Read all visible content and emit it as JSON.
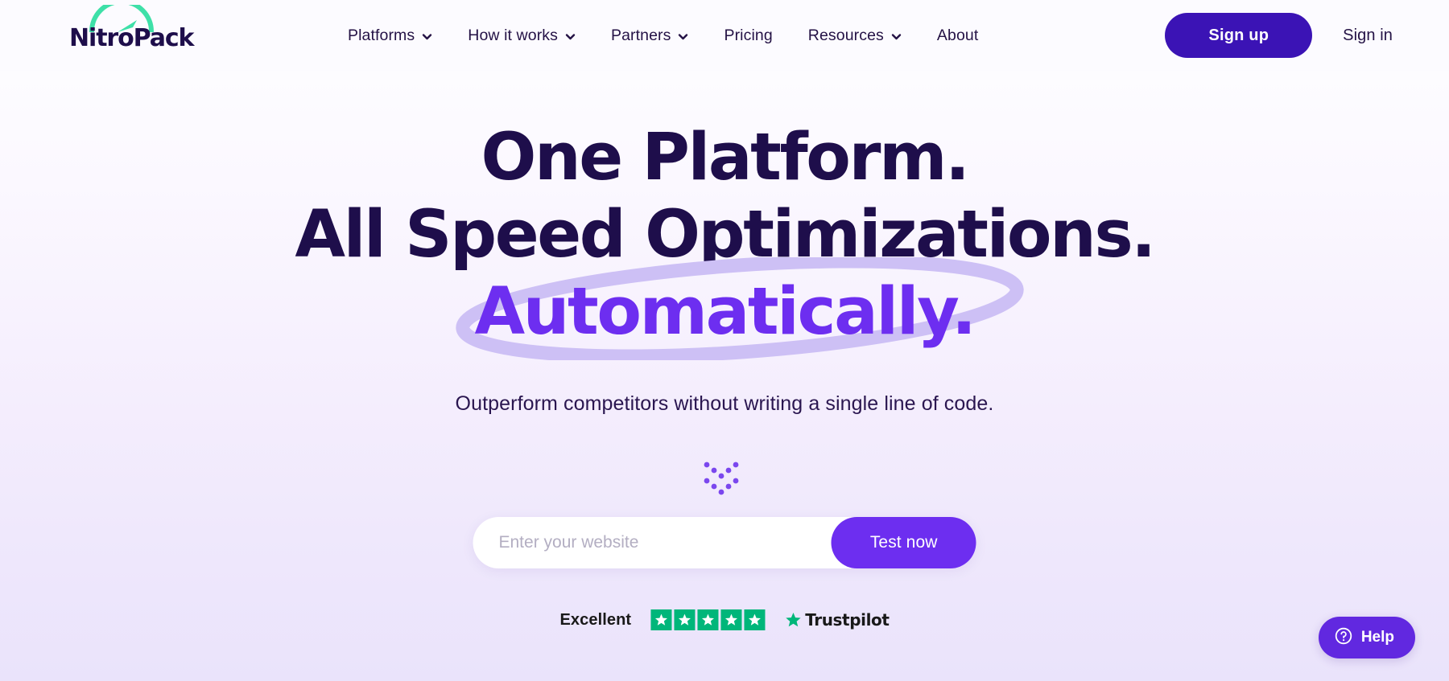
{
  "brand": {
    "name": "NitroPack",
    "logo_icon": "speedometer-icon",
    "arc_color": "#3ee0a8",
    "wordmark_color": "#1e0e4b"
  },
  "header": {
    "nav": [
      {
        "label": "Platforms",
        "has_dropdown": true
      },
      {
        "label": "How it works",
        "has_dropdown": true
      },
      {
        "label": "Partners",
        "has_dropdown": true
      },
      {
        "label": "Pricing",
        "has_dropdown": false
      },
      {
        "label": "Resources",
        "has_dropdown": true
      },
      {
        "label": "About",
        "has_dropdown": false
      }
    ],
    "signup_label": "Sign up",
    "signin_label": "Sign in",
    "signup_color": "#3b13b5"
  },
  "hero": {
    "headline_line1": "One Platform.",
    "headline_line2": "All Speed Optimizations.",
    "headline_line3": "Automatically.",
    "headline_color": "#1e0e4b",
    "accent_color": "#6d2ef0",
    "ring_color": "#cdc0f5",
    "subtitle": "Outperform competitors without writing a single line of code.",
    "scroll_hint_icon": "double-chevron-down-dots-icon"
  },
  "search": {
    "placeholder": "Enter your website",
    "value": "",
    "button_label": "Test now",
    "button_color": "#6d2ef0"
  },
  "trustpilot": {
    "rating_label": "Excellent",
    "stars": 5,
    "star_color": "#00b67a",
    "brand_name": "Trustpilot",
    "star_icon": "star-icon"
  },
  "help": {
    "label": "Help",
    "icon": "question-circle-icon",
    "color": "#6128e0"
  }
}
